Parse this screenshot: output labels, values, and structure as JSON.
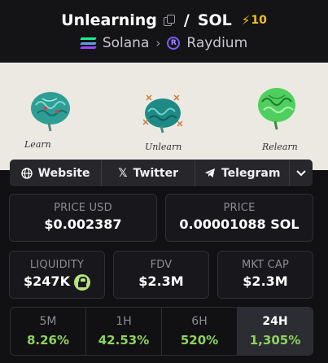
{
  "header": {
    "token_name": "Unlearning",
    "separator": "/",
    "quote": "SOL",
    "boost_count": "10",
    "chain": "Solana",
    "dex": "Raydium"
  },
  "banner": {
    "labels": [
      "Learn",
      "Unlearn",
      "Relearn"
    ]
  },
  "links": {
    "website": "Website",
    "twitter": "Twitter",
    "telegram": "Telegram"
  },
  "prices": {
    "usd_label": "PRICE USD",
    "usd_value": "$0.002387",
    "native_label": "PRICE",
    "native_value": "0.00001088 SOL"
  },
  "stats": {
    "liquidity_label": "LIQUIDITY",
    "liquidity_value": "$247K",
    "fdv_label": "FDV",
    "fdv_value": "$2.3M",
    "mcap_label": "MKT CAP",
    "mcap_value": "$2.3M"
  },
  "timeframes": [
    {
      "label": "5M",
      "value": "8.26%"
    },
    {
      "label": "1H",
      "value": "42.53%"
    },
    {
      "label": "6H",
      "value": "520%"
    },
    {
      "label": "24H",
      "value": "1,305%"
    }
  ],
  "colors": {
    "positive": "#8fd35c",
    "boost": "#f3c21a",
    "solana_gradient": [
      "#14f195",
      "#9945ff"
    ]
  }
}
